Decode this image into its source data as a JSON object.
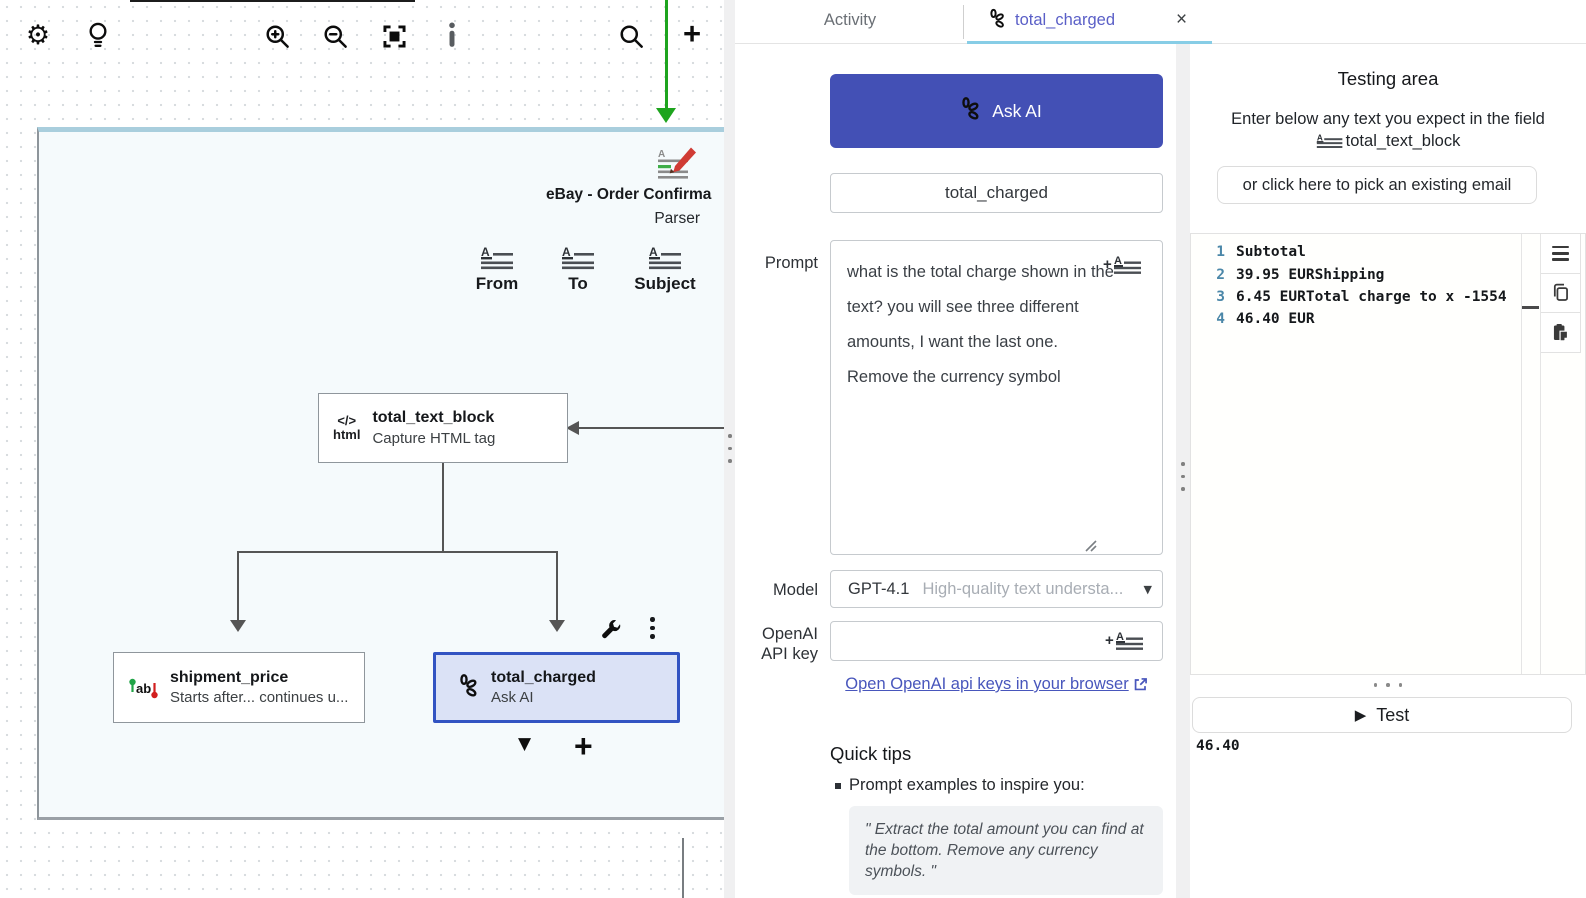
{
  "colors": {
    "accent_indigo": "#4350b5",
    "tab_active_text": "#5a5fc7",
    "tab_underline": "#87cde6",
    "selected_node_border": "#3253c2",
    "selected_node_fill": "#dbe2f6",
    "link": "#4856bc",
    "connector_green": "#1ea41e",
    "code_line_number": "#4b87a8"
  },
  "canvas": {
    "parser": {
      "title": "eBay - Order Confirma",
      "type_label": "Parser",
      "fields": [
        {
          "label": "From"
        },
        {
          "label": "To"
        },
        {
          "label": "Subject"
        }
      ]
    },
    "nodes": [
      {
        "icon_line1": "</>",
        "icon_line2": "html",
        "title": "total_text_block",
        "subtitle": "Capture HTML tag"
      },
      {
        "title": "shipment_price",
        "subtitle": "Starts after... continues u..."
      },
      {
        "title": "total_charged",
        "subtitle": "Ask AI"
      }
    ]
  },
  "tabs": {
    "activity_label": "Activity",
    "active_label": "total_charged",
    "close_glyph": "×"
  },
  "editor": {
    "ask_ai_label": "Ask AI",
    "field_name_value": "total_charged",
    "prompt_label": "Prompt",
    "prompt_value": "what is the total charge shown in the text? you will see three different amounts, I want the last one. Remove the currency symbol",
    "model_label": "Model",
    "model_value": "GPT-4.1",
    "model_description": "High-quality text understa...",
    "model_caret": "▼",
    "api_key_label": "OpenAI API key",
    "api_key_value": "",
    "api_link_label": "Open OpenAI api keys in your browser",
    "quick_tips_title": "Quick tips",
    "tip_item": "Prompt examples to inspire you:",
    "tip_quote": "\" Extract the total amount you can find at the bottom. Remove any currency symbols. \""
  },
  "testing": {
    "title": "Testing area",
    "instruction_line": "Enter below any text you expect in the field",
    "field_ref": "total_text_block",
    "pick_email_label": "or click here to pick an existing email",
    "code_lines": [
      {
        "n": "1",
        "text": "Subtotal"
      },
      {
        "n": "2",
        "text": "39.95 EURShipping"
      },
      {
        "n": "3",
        "text": "6.45 EURTotal charge to x -1554"
      },
      {
        "n": "4",
        "text": "46.40 EUR"
      }
    ],
    "test_play_glyph": "▶",
    "test_label": "Test",
    "result_value": "46.40"
  },
  "glyphs": {
    "gear": "⚙",
    "toolbar_plus": "+",
    "canvas_plus": "+",
    "triangle_down": "▼"
  }
}
